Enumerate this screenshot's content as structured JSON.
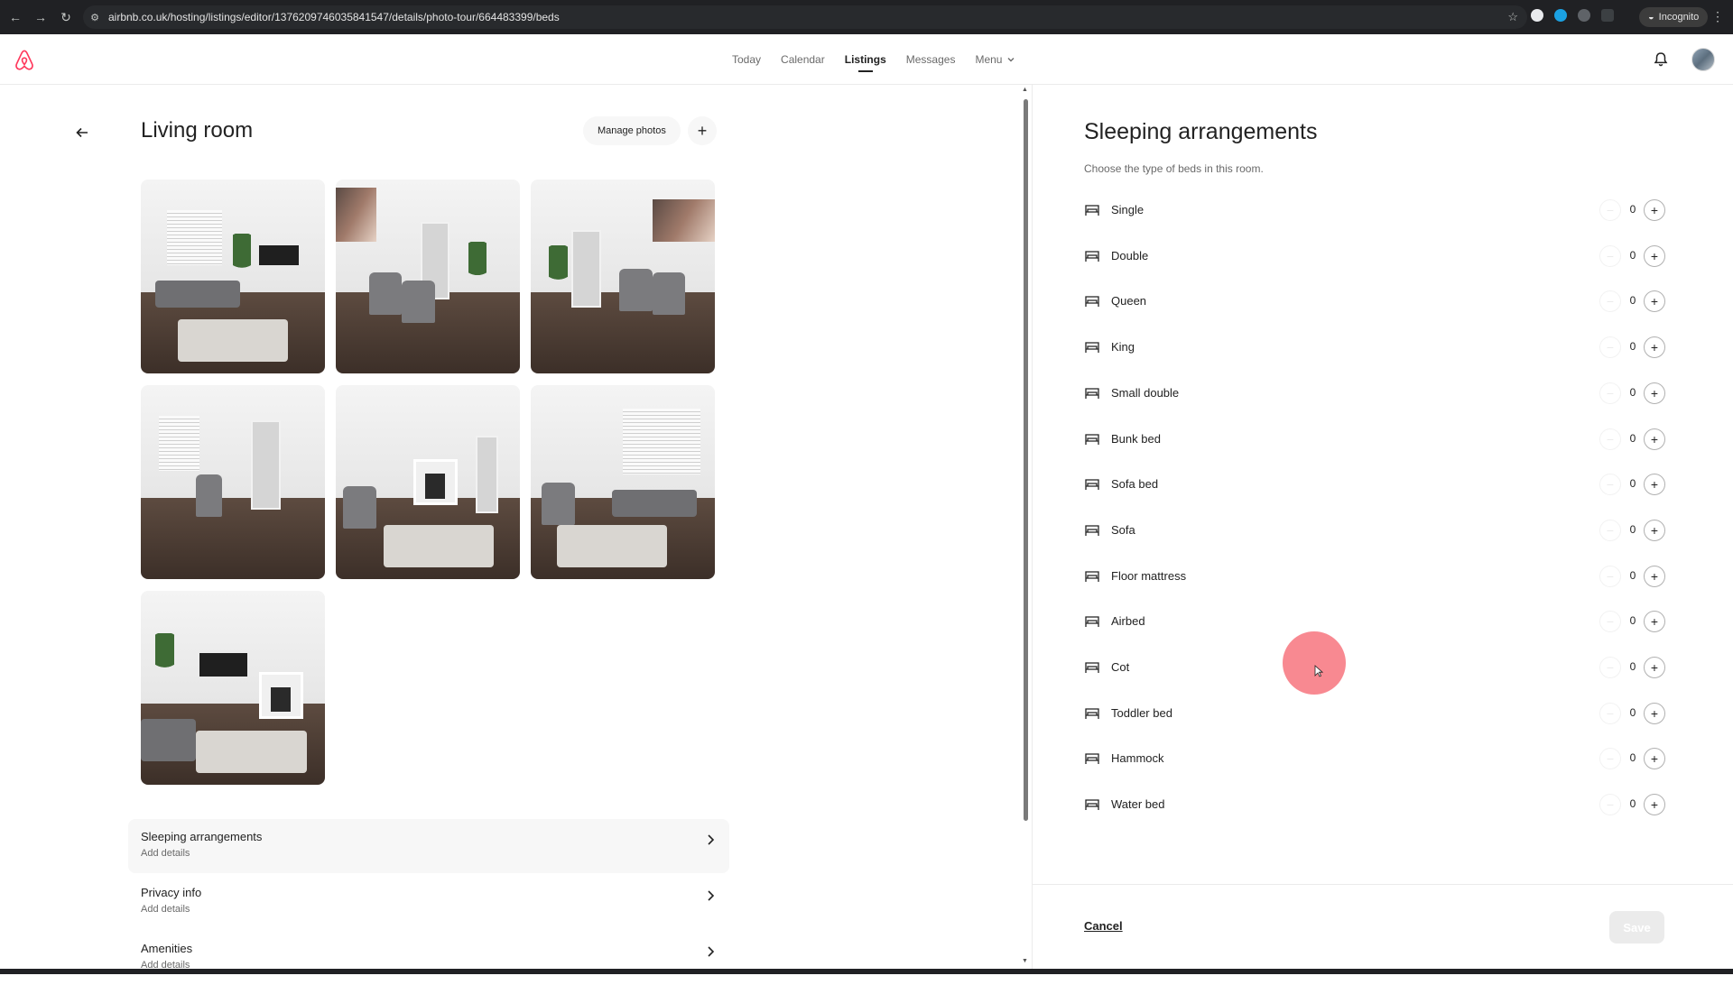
{
  "browser": {
    "url": "airbnb.co.uk/hosting/listings/editor/1376209746035841547/details/photo-tour/664483399/beds",
    "incognito_label": "Incognito"
  },
  "header": {
    "nav": [
      "Today",
      "Calendar",
      "Listings",
      "Messages",
      "Menu"
    ],
    "active_nav": "Listings",
    "brand_color": "#FF385C"
  },
  "room": {
    "title": "Living room",
    "manage_photos_label": "Manage photos",
    "photo_count": 7,
    "sections": [
      {
        "label": "Sleeping arrangements",
        "sub": "Add details"
      },
      {
        "label": "Privacy info",
        "sub": "Add details"
      },
      {
        "label": "Amenities",
        "sub": "Add details"
      }
    ]
  },
  "sleeping": {
    "title": "Sleeping arrangements",
    "subtitle": "Choose the type of beds in this room.",
    "beds": [
      {
        "label": "Single",
        "count": "0"
      },
      {
        "label": "Double",
        "count": "0"
      },
      {
        "label": "Queen",
        "count": "0"
      },
      {
        "label": "King",
        "count": "0"
      },
      {
        "label": "Small double",
        "count": "0"
      },
      {
        "label": "Bunk bed",
        "count": "0"
      },
      {
        "label": "Sofa bed",
        "count": "0"
      },
      {
        "label": "Sofa",
        "count": "0"
      },
      {
        "label": "Floor mattress",
        "count": "0"
      },
      {
        "label": "Airbed",
        "count": "0"
      },
      {
        "label": "Cot",
        "count": "0"
      },
      {
        "label": "Toddler bed",
        "count": "0"
      },
      {
        "label": "Hammock",
        "count": "0"
      },
      {
        "label": "Water bed",
        "count": "0"
      }
    ],
    "plus_symbol": "+",
    "minus_symbol": "−"
  },
  "footer": {
    "cancel_label": "Cancel",
    "save_label": "Save"
  }
}
